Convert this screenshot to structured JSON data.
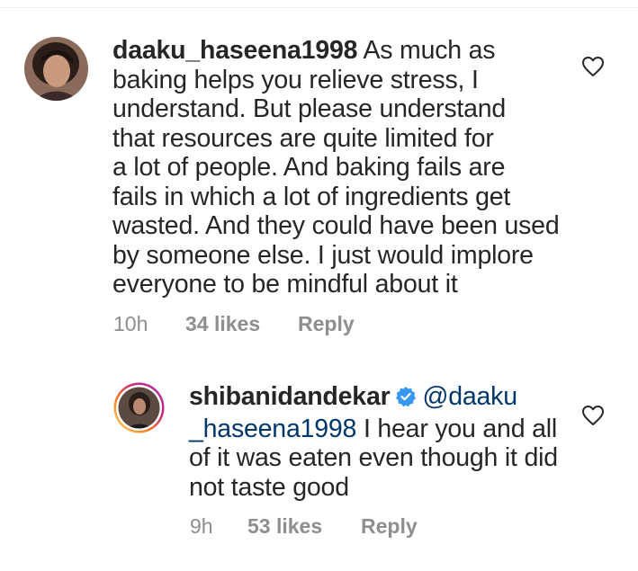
{
  "comments": [
    {
      "username": "daaku_haseena1998",
      "lines": [
        "As much as",
        "baking helps you relieve stress, I",
        "understand. But please understand",
        "that resources are quite limited for",
        "a lot of people. And baking fails are",
        "fails in which a lot of ingredients get",
        "wasted. And they could have been used",
        "by someone else. I just would implore",
        "everyone to be mindful about it"
      ],
      "time": "10h",
      "likes": "34 likes",
      "reply_label": "Reply",
      "avatar_icon": "user-avatar-photo",
      "like_icon": "heart-outline-icon"
    },
    {
      "username": "shibanidandekar",
      "verified": true,
      "verified_icon": "verified-badge-icon",
      "mention_part1": "@daaku",
      "mention_part2": "_haseena1998",
      "lines": [
        "I hear you and all",
        "of it was eaten even though it did",
        "not taste good"
      ],
      "time": "9h",
      "likes": "53 likes",
      "reply_label": "Reply",
      "avatar_icon": "story-ring-avatar",
      "like_icon": "heart-outline-icon"
    }
  ],
  "colors": {
    "text": "#262626",
    "meta": "#8e8e8e",
    "mention": "#00376b",
    "verified": "#3897f0"
  }
}
